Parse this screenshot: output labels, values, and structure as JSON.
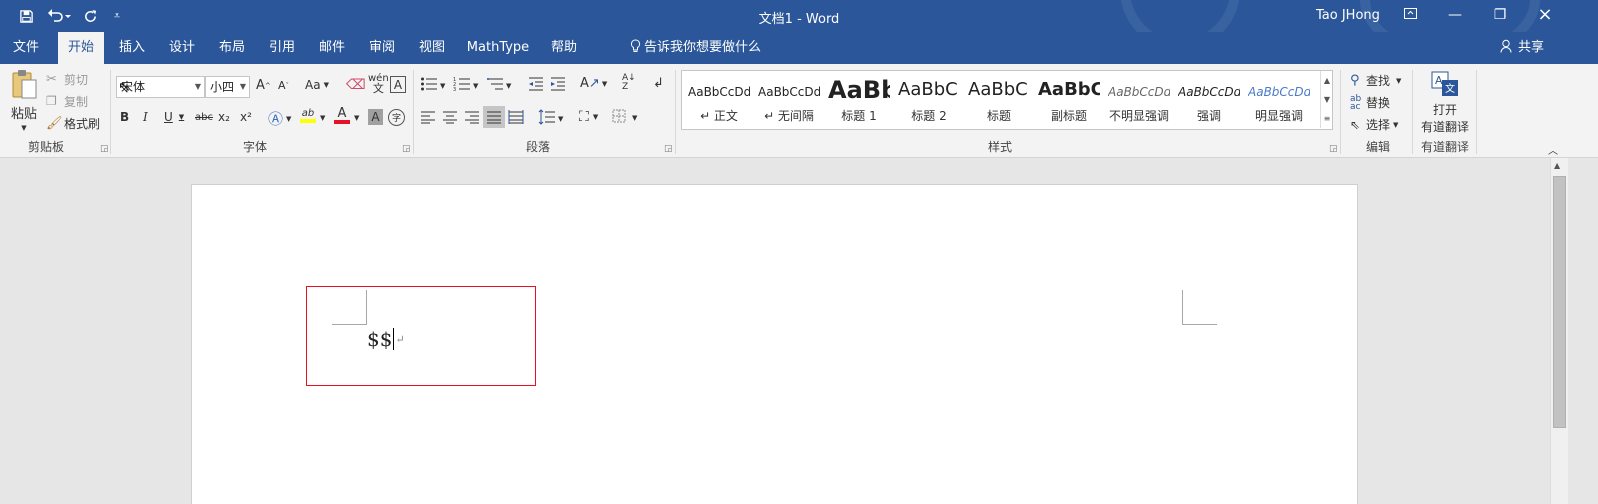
{
  "titlebar": {
    "title": "文档1  -  Word",
    "user": "Tao JHong",
    "qat": {
      "save_icon": "save-icon",
      "undo_icon": "undo-icon",
      "redo_icon": "redo-icon",
      "customize_icon": "customize-qat-icon"
    }
  },
  "tabs": [
    {
      "label": "文件"
    },
    {
      "label": "开始",
      "active": true
    },
    {
      "label": "插入"
    },
    {
      "label": "设计"
    },
    {
      "label": "布局"
    },
    {
      "label": "引用"
    },
    {
      "label": "邮件"
    },
    {
      "label": "审阅"
    },
    {
      "label": "视图"
    },
    {
      "label": "MathType"
    },
    {
      "label": "帮助"
    }
  ],
  "tell_me": "告诉我你想要做什么",
  "share": "共享",
  "clipboard": {
    "paste": "粘贴",
    "cut": "剪切",
    "copy": "复制",
    "format_painter": "格式刷",
    "group": "剪贴板"
  },
  "font": {
    "name": "宋体",
    "size": "小四",
    "group": "字体",
    "grow": "A",
    "shrink": "A",
    "case": "Aa",
    "bold": "B",
    "italic": "I",
    "underline": "U",
    "strike": "abc",
    "sub": "x₂",
    "sup": "x²",
    "pinyin": "wén",
    "border_char": "A",
    "highlight": "ab",
    "color": "A",
    "shade": "A",
    "circle": "字"
  },
  "paragraph": {
    "group": "段落"
  },
  "styles": {
    "group": "样式",
    "items": [
      {
        "preview": "AaBbCcDd",
        "name": "↵ 正文"
      },
      {
        "preview": "AaBbCcDd",
        "name": "↵ 无间隔"
      },
      {
        "preview": "AaBb",
        "name": "标题 1"
      },
      {
        "preview": "AaBbC",
        "name": "标题 2"
      },
      {
        "preview": "AaBbC",
        "name": "标题"
      },
      {
        "preview": "AaBbC",
        "name": "副标题"
      },
      {
        "preview": "AaBbCcDd",
        "name": "不明显强调"
      },
      {
        "preview": "AaBbCcDd",
        "name": "强调"
      },
      {
        "preview": "AaBbCcDd",
        "name": "明显强调"
      }
    ]
  },
  "editing": {
    "find": "查找",
    "replace": "替换",
    "select": "选择",
    "group": "编辑"
  },
  "youdao": {
    "open": "打开",
    "name": "有道翻译",
    "group": "有道翻译"
  },
  "document": {
    "text": "$$",
    "para_mark": "↵"
  },
  "colors": {
    "brand": "#2b579a",
    "annotation": "#e81123"
  }
}
